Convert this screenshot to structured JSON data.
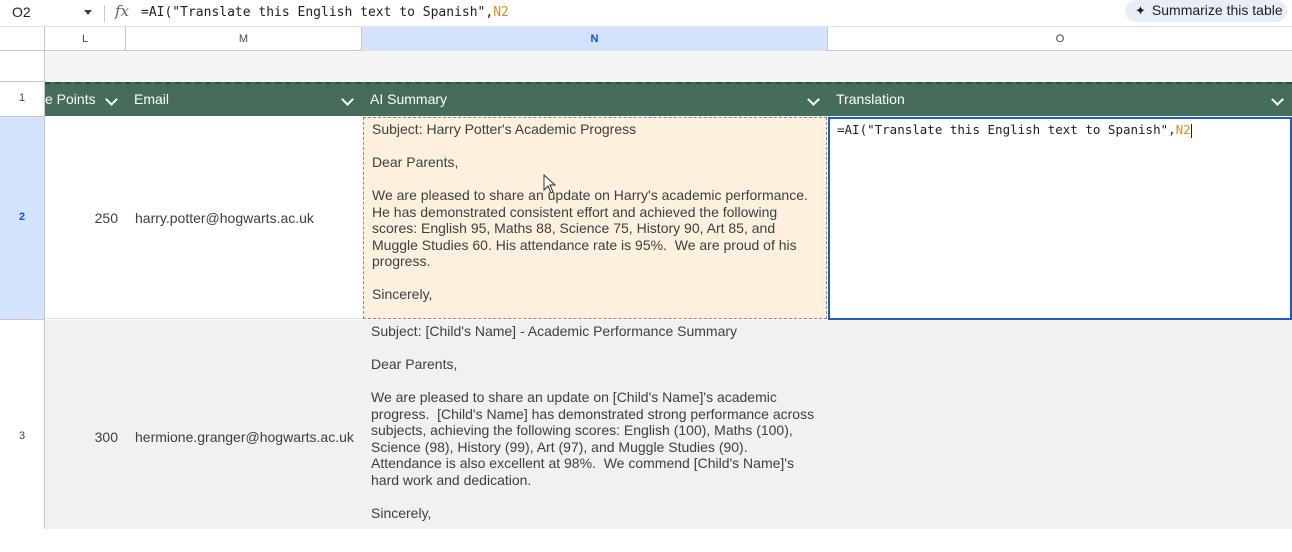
{
  "formula_bar": {
    "name_box": "O2",
    "fx_label": "fx",
    "formula_prefix": "=AI(\"Translate this English text to Spanish\",",
    "formula_ref": "N2",
    "summarize_label": "Summarize this table"
  },
  "columns": {
    "L": "L",
    "M": "M",
    "N": "N",
    "O": "O"
  },
  "row_numbers": {
    "r1": "1",
    "r2": "2",
    "r3": "3"
  },
  "table": {
    "headers": {
      "points": "e Points",
      "email": "Email",
      "summary": "AI Summary",
      "translation": "Translation"
    },
    "rows": [
      {
        "points": "250",
        "email": "harry.potter@hogwarts.ac.uk",
        "summary": "Subject: Harry Potter's Academic Progress\n\nDear Parents,\n\nWe are pleased to share an update on Harry's academic performance.  He has demonstrated consistent effort and achieved the following scores: English 95, Maths 88, Science 75, History 90, Art 85, and Muggle Studies 60. His attendance rate is 95%.  We are proud of his progress.\n\nSincerely,\n\n[School Name/Teacher Name]",
        "translation_prefix": "=AI(\"Translate this English text to Spanish\",",
        "translation_ref": "N2"
      },
      {
        "points": "300",
        "email": "hermione.granger@hogwarts.ac.uk",
        "summary": "Subject: [Child's Name] - Academic Performance Summary\n\nDear Parents,\n\nWe are pleased to share an update on [Child's Name]'s academic progress.  [Child's Name] has demonstrated strong performance across subjects, achieving the following scores: English (100), Maths (100), Science (98), History (99), Art (97), and Muggle Studies (90).  Attendance is also excellent at 98%.  We commend [Child's Name]'s hard work and dedication.\n\nSincerely,"
      }
    ]
  },
  "colors": {
    "header_green": "#456d5a",
    "selection_blue": "#1a5dc8",
    "source_highlight": "#fdf1de"
  }
}
